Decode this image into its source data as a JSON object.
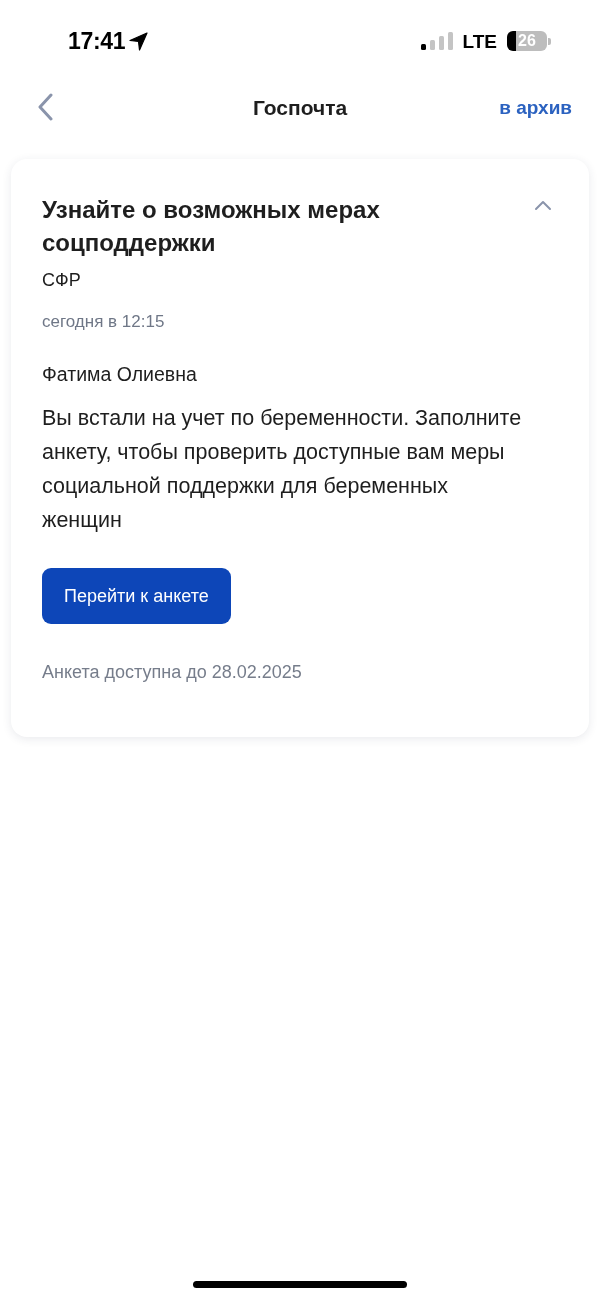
{
  "status_bar": {
    "time": "17:41",
    "network": "LTE",
    "battery": "26"
  },
  "nav": {
    "title": "Госпочта",
    "action": "в архив"
  },
  "message": {
    "title": "Узнайте о возможных мерах соцподдержки",
    "expanded": true,
    "sender": "СФР",
    "date": "сегодня в 12:15",
    "recipient": "Фатима Олиевна",
    "body": "Вы встали на учет по беременности. Заполните анкету, чтобы проверить доступные вам меры социальной поддержки для беременных женщин",
    "button": "Перейти к анкете",
    "note": "Анкета доступна до 28.02.2025"
  }
}
